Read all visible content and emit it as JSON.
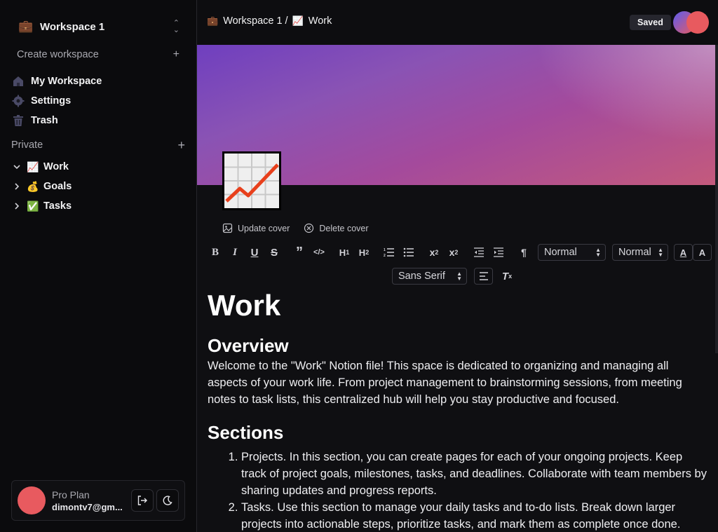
{
  "sidebar": {
    "workspace": {
      "emoji": "💼",
      "name": "Workspace 1"
    },
    "create_workspace": "Create workspace",
    "nav": [
      {
        "label": "My Workspace",
        "icon": "home-icon"
      },
      {
        "label": "Settings",
        "icon": "gear-icon"
      },
      {
        "label": "Trash",
        "icon": "trash-icon"
      }
    ],
    "private_label": "Private",
    "pages": [
      {
        "emoji": "📈",
        "label": "Work",
        "expanded": true
      },
      {
        "emoji": "💰",
        "label": "Goals",
        "expanded": false
      },
      {
        "emoji": "✅",
        "label": "Tasks",
        "expanded": false
      }
    ],
    "user": {
      "plan": "Pro Plan",
      "email": "dimontv7@gm..."
    }
  },
  "topbar": {
    "breadcrumb": [
      {
        "emoji": "💼",
        "label": "Workspace 1"
      },
      {
        "emoji": "📈",
        "label": "Work"
      }
    ],
    "separator": "/",
    "status": "Saved"
  },
  "cover": {
    "update_label": "Update cover",
    "delete_label": "Delete cover"
  },
  "toolbar": {
    "header_select": "Normal",
    "size_select": "Normal",
    "font_select": "Sans Serif"
  },
  "document": {
    "title": "Work",
    "overview_heading": "Overview",
    "overview_text": "Welcome to the \"Work\" Notion file! This space is dedicated to organizing and managing all aspects of your work life. From project management to brainstorming sessions, from meeting notes to task lists, this centralized hub will help you stay productive and focused.",
    "sections_heading": "Sections",
    "sections": [
      "Projects. In this section, you can create pages for each of your ongoing projects. Keep track of project goals, milestones, tasks, and deadlines. Collaborate with team members by sharing updates and progress reports.",
      "Tasks. Use this section to manage your daily tasks and to-do lists. Break down larger projects into actionable steps, prioritize tasks, and mark them as complete once done."
    ]
  },
  "colors": {
    "avatar": "#e85a5f",
    "cover_start": "#6f3fbf",
    "cover_end": "#c45a7c"
  }
}
